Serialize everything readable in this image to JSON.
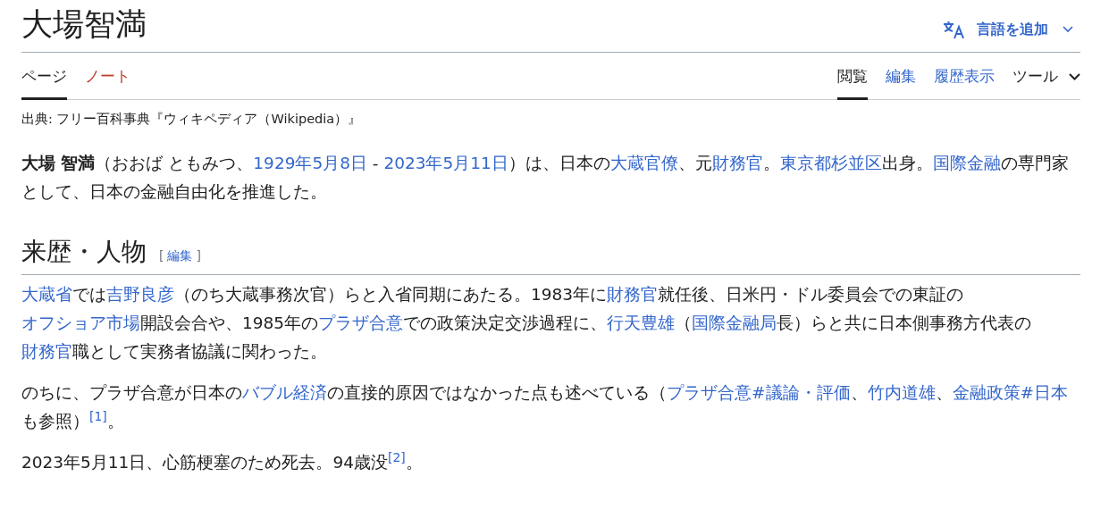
{
  "title": "大場智満",
  "language_button": {
    "label": "言語を追加"
  },
  "namespace_tabs": [
    {
      "label": "ページ",
      "selected": true,
      "exists": true
    },
    {
      "label": "ノート",
      "selected": false,
      "exists": false
    }
  ],
  "view_tabs": [
    {
      "label": "閲覧",
      "selected": true,
      "kind": "tab"
    },
    {
      "label": "編集",
      "selected": false,
      "kind": "tab"
    },
    {
      "label": "履歴表示",
      "selected": false,
      "kind": "tab"
    },
    {
      "label": "ツール",
      "selected": false,
      "kind": "menu"
    }
  ],
  "tagline": "出典: フリー百科事典『ウィキペディア（Wikipedia）』",
  "lead": [
    {
      "kind": "bold",
      "text": "大場 智満"
    },
    {
      "kind": "text",
      "text": "（おおば ともみつ、"
    },
    {
      "kind": "link",
      "text": "1929年5月8日"
    },
    {
      "kind": "text",
      "text": " - "
    },
    {
      "kind": "link",
      "text": "2023年5月11日"
    },
    {
      "kind": "text",
      "text": "）は、日本の"
    },
    {
      "kind": "link",
      "text": "大蔵官僚"
    },
    {
      "kind": "text",
      "text": "、元"
    },
    {
      "kind": "link",
      "text": "財務官"
    },
    {
      "kind": "text",
      "text": "。"
    },
    {
      "kind": "link",
      "text": "東京都杉並区"
    },
    {
      "kind": "text",
      "text": "出身。"
    },
    {
      "kind": "link",
      "text": "国際金融"
    },
    {
      "kind": "text",
      "text": "の専門家として、日本の金融自由化を推進した。"
    }
  ],
  "section": {
    "heading": "来歴・人物",
    "edit_open": "[",
    "edit_label": "編集",
    "edit_close": "]",
    "paragraphs": [
      [
        {
          "kind": "link",
          "text": "大蔵省"
        },
        {
          "kind": "text",
          "text": "では"
        },
        {
          "kind": "link",
          "text": "吉野良彦"
        },
        {
          "kind": "text",
          "text": "（のち大蔵事務次官）らと入省同期にあたる。1983年に"
        },
        {
          "kind": "link",
          "text": "財務官"
        },
        {
          "kind": "text",
          "text": "就任後、日米円・ドル委員会での東証の"
        },
        {
          "kind": "link",
          "text": "オフショア市場"
        },
        {
          "kind": "text",
          "text": "開設会合や、1985年の"
        },
        {
          "kind": "link",
          "text": "プラザ合意"
        },
        {
          "kind": "text",
          "text": "での政策決定交渉過程に、"
        },
        {
          "kind": "link",
          "text": "行天豊雄"
        },
        {
          "kind": "text",
          "text": "（"
        },
        {
          "kind": "link",
          "text": "国際金融局"
        },
        {
          "kind": "text",
          "text": "長）らと共に日本側事務方代表の"
        },
        {
          "kind": "link",
          "text": "財務官"
        },
        {
          "kind": "text",
          "text": "職として実務者協議に関わった。"
        }
      ],
      [
        {
          "kind": "text",
          "text": "のちに、プラザ合意が日本の"
        },
        {
          "kind": "link",
          "text": "バブル経済"
        },
        {
          "kind": "text",
          "text": "の直接的原因ではなかった点も述べている（"
        },
        {
          "kind": "link",
          "text": "プラザ合意#議論・評価"
        },
        {
          "kind": "text",
          "text": "、"
        },
        {
          "kind": "link",
          "text": "竹内道雄"
        },
        {
          "kind": "text",
          "text": "、"
        },
        {
          "kind": "link",
          "text": "金融政策#日本"
        },
        {
          "kind": "text",
          "text": "も参照）"
        },
        {
          "kind": "ref",
          "text": "[1]"
        },
        {
          "kind": "text",
          "text": "。"
        }
      ],
      [
        {
          "kind": "text",
          "text": "2023年5月11日、心筋梗塞のため死去。94歳没"
        },
        {
          "kind": "ref",
          "text": "[2]"
        },
        {
          "kind": "text",
          "text": "。"
        }
      ]
    ]
  }
}
